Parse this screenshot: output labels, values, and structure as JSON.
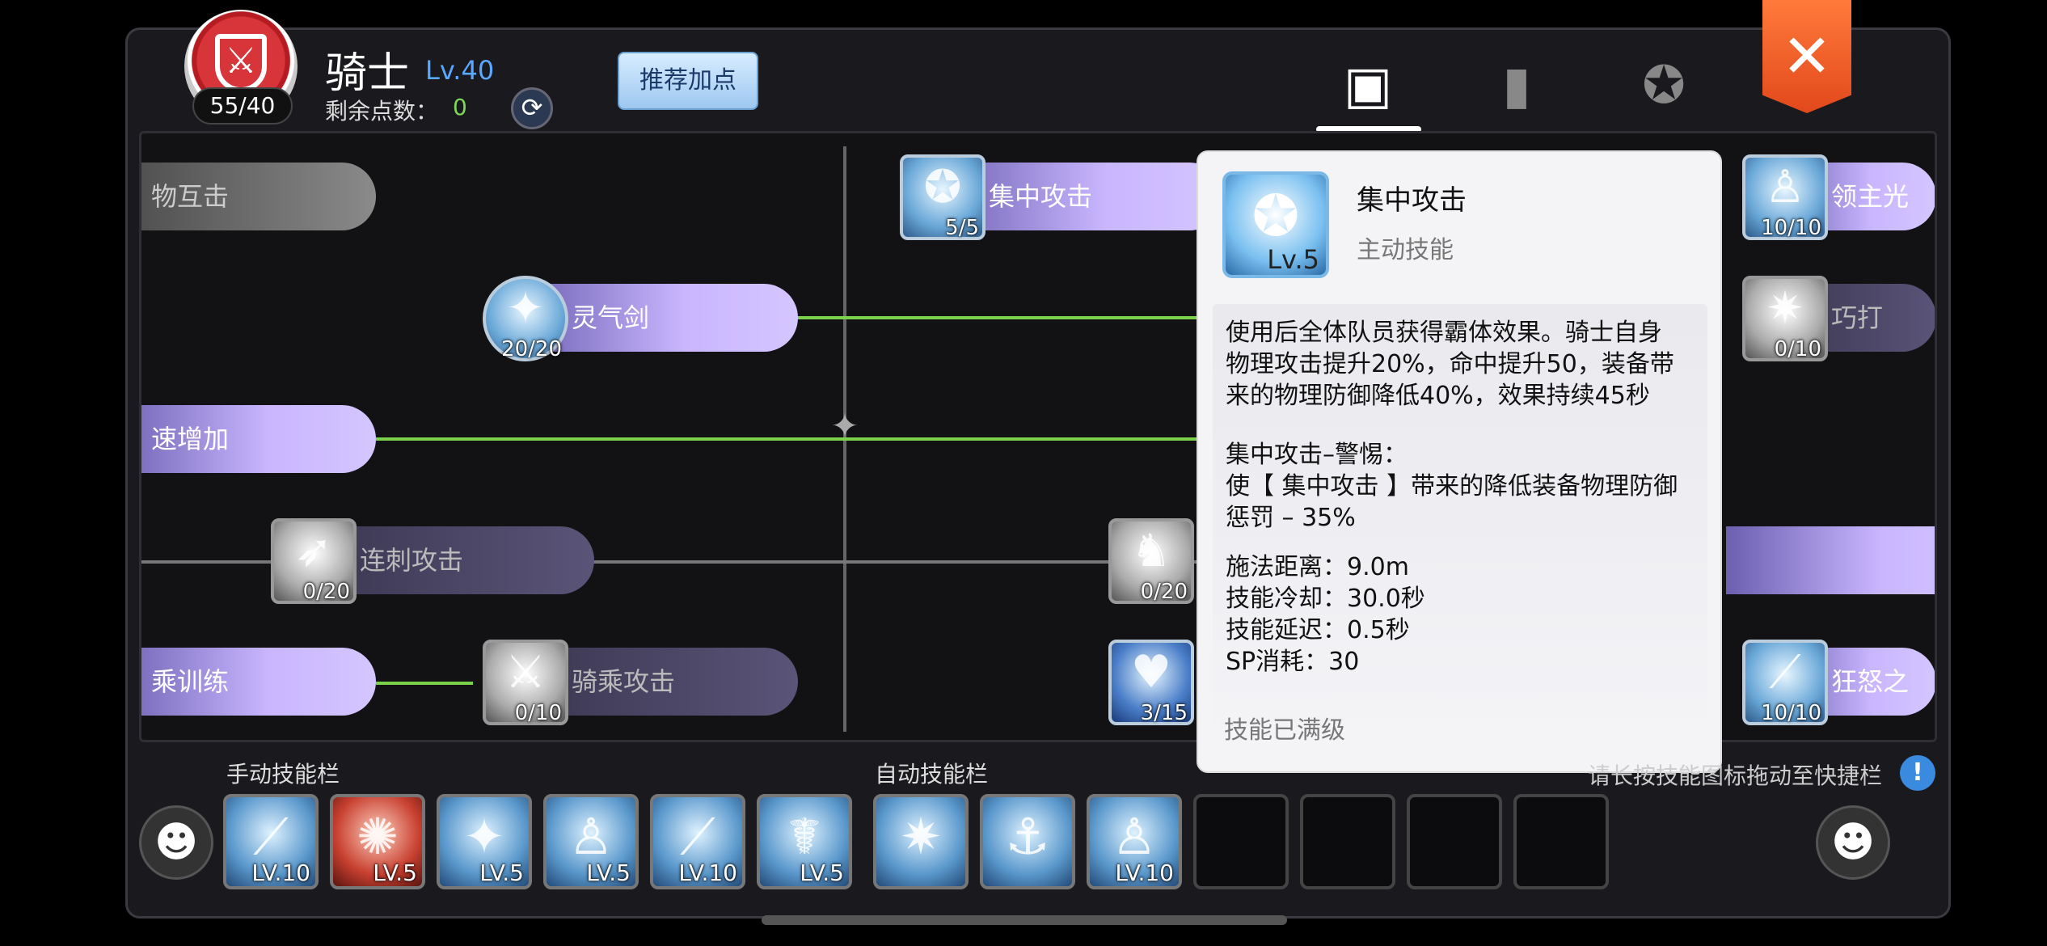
{
  "header": {
    "class_name": "骑士",
    "class_level": "Lv.40",
    "points_badge": "55/40",
    "remaining_label": "剩余点数：",
    "remaining_value": "0",
    "recommend_button": "推荐加点",
    "tabs": [
      {
        "icon": "contact-book-icon",
        "active": true
      },
      {
        "icon": "book-icon",
        "active": false
      },
      {
        "icon": "star-emblem-icon",
        "active": false
      }
    ]
  },
  "skills": [
    {
      "id": "s1",
      "label": "物互击",
      "level": ""
    },
    {
      "id": "s2",
      "label": "灵气剑",
      "level": "20/20"
    },
    {
      "id": "s3",
      "label": "速增加",
      "level": ""
    },
    {
      "id": "s4",
      "label": "连刺攻击",
      "level": "0/20"
    },
    {
      "id": "s5",
      "label": "乘训练",
      "level": ""
    },
    {
      "id": "s6",
      "label": "骑乘攻击",
      "level": "0/10"
    },
    {
      "id": "s7",
      "label": "集中攻击",
      "level": "5/5"
    },
    {
      "id": "s8",
      "label": "",
      "level": "0/20"
    },
    {
      "id": "s9",
      "label": "",
      "level": "3/15"
    },
    {
      "id": "s10",
      "label": "领主光",
      "level": "10/10"
    },
    {
      "id": "s11",
      "label": "巧打",
      "level": "0/10"
    },
    {
      "id": "s12",
      "label": "狂怒之",
      "level": "10/10"
    }
  ],
  "tooltip": {
    "title": "集中攻击",
    "type": "主动技能",
    "icon_level": "Lv.5",
    "desc_lines": [
      "使用后全体队员获得霸体效果。骑士自身",
      "物理攻击提升20%，命中提升50，装备带",
      "来的物理防御降低40%，效果持续45秒"
    ],
    "sub_title": "集中攻击–警惕：",
    "sub_lines": [
      "使【 集中攻击 】带来的降低装备物理防御",
      "惩罚 – 35%"
    ],
    "stats": [
      "施法距离：9.0m",
      "技能冷却：30.0秒",
      "技能延迟：0.5秒",
      "SP消耗：30"
    ],
    "footer": "技能已满级"
  },
  "manual_bar": {
    "label": "手动技能栏",
    "slots": [
      {
        "level": "LV.10",
        "kind": "blue"
      },
      {
        "level": "LV.5",
        "kind": "red"
      },
      {
        "level": "LV.5",
        "kind": "blue"
      },
      {
        "level": "LV.5",
        "kind": "blue"
      },
      {
        "level": "LV.10",
        "kind": "blue"
      },
      {
        "level": "LV.5",
        "kind": "blue"
      }
    ]
  },
  "auto_bar": {
    "label": "自动技能栏",
    "slots": [
      {
        "level": "",
        "kind": "blue"
      },
      {
        "level": "",
        "kind": "blue"
      },
      {
        "level": "LV.10",
        "kind": "blue"
      },
      {
        "level": "",
        "kind": "empty"
      },
      {
        "level": "",
        "kind": "empty"
      },
      {
        "level": "",
        "kind": "empty"
      },
      {
        "level": "",
        "kind": "empty"
      }
    ]
  },
  "hint": "请长按技能图标拖动至快捷栏",
  "close_label": "✕"
}
